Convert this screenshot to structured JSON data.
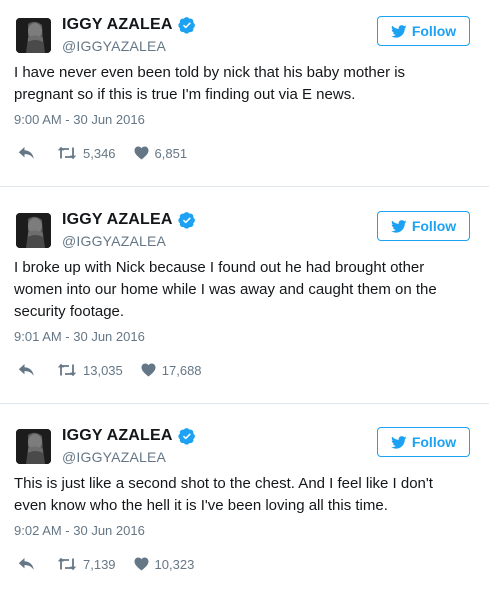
{
  "colors": {
    "accent": "#1da1f2",
    "secondary_text": "#657786",
    "separator": "#e1e8ed"
  },
  "tweets": [
    {
      "name": "IGGY AZALEA",
      "handle": "@IGGYAZALEA",
      "follow_label": "Follow",
      "text": "I have never even been told by nick that his baby mother is pregnant so if this is true I'm finding out via E news.",
      "time": "9:00 AM - 30 Jun 2016",
      "retweets": "5,346",
      "likes": "6,851"
    },
    {
      "name": "IGGY AZALEA",
      "handle": "@IGGYAZALEA",
      "follow_label": "Follow",
      "text": "I broke up with Nick because I found out he had brought other women into our home while I was away and caught them on the security footage.",
      "time": "9:01 AM - 30 Jun 2016",
      "retweets": "13,035",
      "likes": "17,688"
    },
    {
      "name": "IGGY AZALEA",
      "handle": "@IGGYAZALEA",
      "follow_label": "Follow",
      "text": "This is just like a second shot to the chest. And I feel like I don't even know who the hell it is I've been loving all this time.",
      "time": "9:02 AM - 30 Jun 2016",
      "retweets": "7,139",
      "likes": "10,323"
    }
  ]
}
